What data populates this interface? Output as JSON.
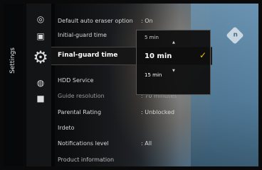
{
  "sidebar": {
    "title": "Settings",
    "icons": [
      "clock-icon",
      "tv-icon",
      "gear-icon",
      "globe-icon",
      "record-icon"
    ]
  },
  "menu": {
    "items": [
      {
        "label": "Default auto eraser option",
        "value": ": On"
      },
      {
        "label": "Initial-guard time",
        "value": ""
      },
      {
        "label": "Final-guard time",
        "value": ""
      },
      {
        "label": "HDD Service",
        "value": ""
      },
      {
        "label": "Guide resolution",
        "value": ": 70 minutes"
      },
      {
        "label": "Parental Rating",
        "value": ": Unblocked"
      },
      {
        "label": "Irdeto",
        "value": ""
      },
      {
        "label": "Notifications level",
        "value": ": All"
      },
      {
        "label": "Product information",
        "value": ""
      }
    ]
  },
  "picker": {
    "above": "5 min",
    "selected": "10 min",
    "below": "15 min",
    "check": "✓"
  },
  "brand": {
    "logo_text": "n"
  },
  "colors": {
    "check": "#f2c400",
    "highlight": "#111111"
  }
}
